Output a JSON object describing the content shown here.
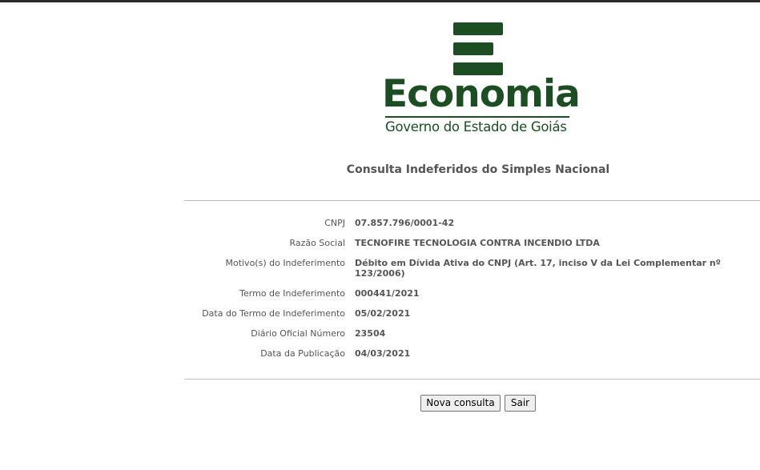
{
  "logo": {
    "word": "Economia",
    "subtitle": "Governo do Estado de Goiás",
    "color": "#1c4d23"
  },
  "page": {
    "title": "Consulta Indeferidos do Simples Nacional"
  },
  "details": [
    {
      "label": "CNPJ",
      "value": "07.857.796/0001-42"
    },
    {
      "label": "Razão Social",
      "value": "TECNOFIRE TECNOLOGIA CONTRA INCENDIO LTDA"
    },
    {
      "label": "Motivo(s) do Indeferimento",
      "value": "Débito em Dívida Ativa do CNPJ (Art. 17, inciso V da Lei Complementar nº 123/2006)"
    },
    {
      "label": "Termo de Indeferimento",
      "value": "000441/2021"
    },
    {
      "label": "Data do Termo de Indeferimento",
      "value": "05/02/2021"
    },
    {
      "label": "Diário Oficial Número",
      "value": "23504"
    },
    {
      "label": "Data da Publicação",
      "value": "04/03/2021"
    }
  ],
  "buttons": {
    "new_query": "Nova consulta",
    "exit": "Sair"
  }
}
